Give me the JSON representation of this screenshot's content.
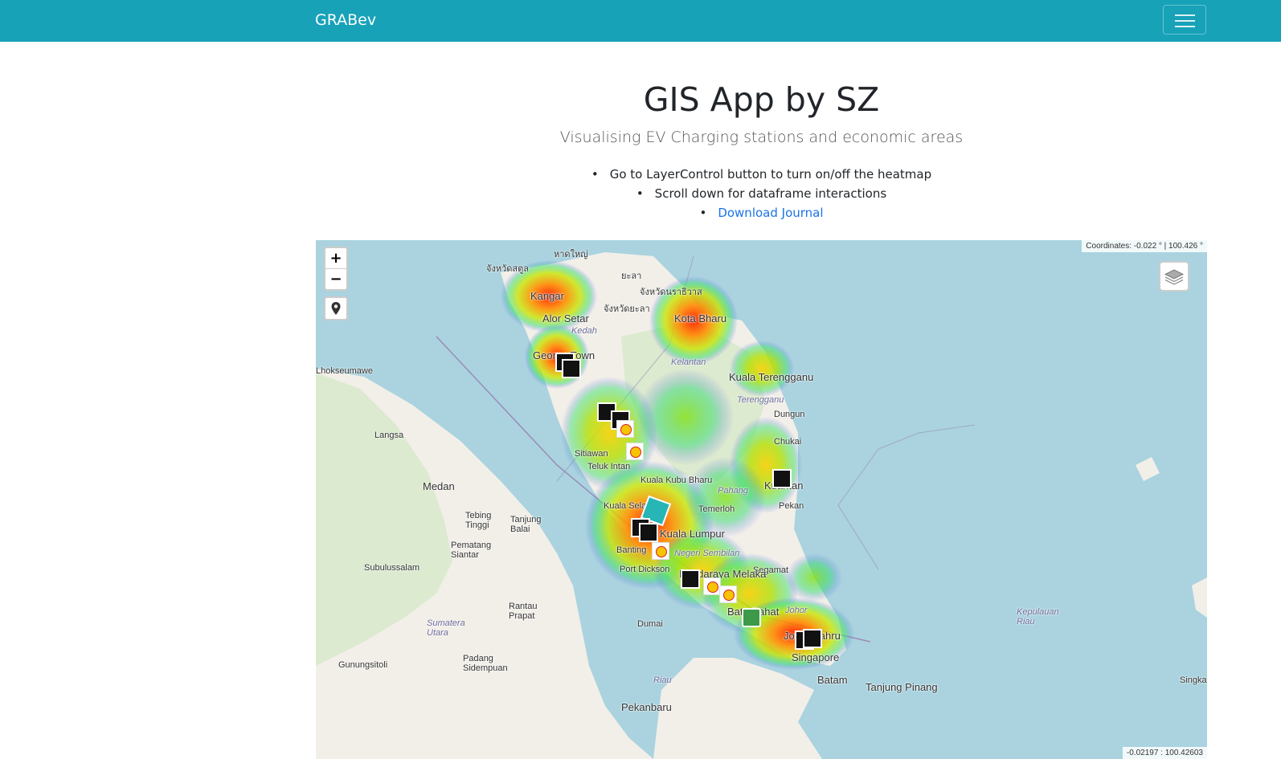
{
  "navbar": {
    "brand": "GRABev",
    "color": "#17a2b8"
  },
  "header": {
    "title": "GIS App by SZ",
    "subtitle": "Visualising EV Charging stations and economic areas",
    "bullets": [
      "Go to LayerControl button to turn on/off the heatmap",
      "Scroll down for dataframe interactions"
    ],
    "link": "Download Journal"
  },
  "map": {
    "coordinates_top": "Coordinates: -0.022 ° | 100.426 °",
    "coordinates_bottom": "-0.02197 : 100.42603",
    "zoom_in": "+",
    "zoom_out": "−",
    "labels": {
      "kangar": "Kangar",
      "alorsetar": "Alor Setar",
      "kedah": "Kedah",
      "kotabharu": "Kota Bharu",
      "georgetown": "George Town",
      "kelantan": "Kelantan",
      "kualaterengganu": "Kuala Terengganu",
      "terengganu": "Terengganu",
      "dungun": "Dungun",
      "chukai": "Chukai",
      "seumawe": "Lhokseumawe",
      "langsa": "Langsa",
      "medan": "Medan",
      "sitiawan": "Sitiawan",
      "telukintan": "Teluk Intan",
      "kualakubu": "Kuala Kubu Bharu",
      "pahang": "Pahang",
      "kuantan": "Kuantan",
      "pekan": "Pekan",
      "kualaselangor": "Kuala Selangor",
      "temerloh": "Temerloh",
      "tebing": "Tebing Tinggi",
      "tanjungbalai": "Tanjung Balai",
      "pematang": "Pematang Siantar",
      "sembilan": "Negeri Sembilan",
      "banting": "Banting",
      "portdickson": "Port Dickson",
      "segamat": "Segamat",
      "subulussalam": "Subulussalam",
      "batupahat": "Batu Pahat",
      "johor": "Johor",
      "rantau": "Rantau Prapat",
      "dumai": "Dumai",
      "sumatera": "Sumatera Utara",
      "riaukep": "Kepulauan Riau",
      "johorbahru": "Johor Bahru",
      "singapore": "Singapore",
      "gunungsitoli": "Gunungsitoli",
      "padang": "Padang Sidempuan",
      "riau": "Riau",
      "batam": "Batam",
      "tanjungpinang": "Tanjung Pinang",
      "pekanbaru": "Pekanbaru",
      "singkawang": "Singkawa",
      "satun": "จังหวัดสตูล",
      "hatyai": "หาดใหญ่",
      "yala": "ยะลา",
      "narathiwat": "จังหวัดนราธิวาส",
      "yalaprov": "จังหวัดยะลา",
      "melaka": "Bandaraya Melaka",
      "kl": "Kuala Lumpur"
    }
  }
}
